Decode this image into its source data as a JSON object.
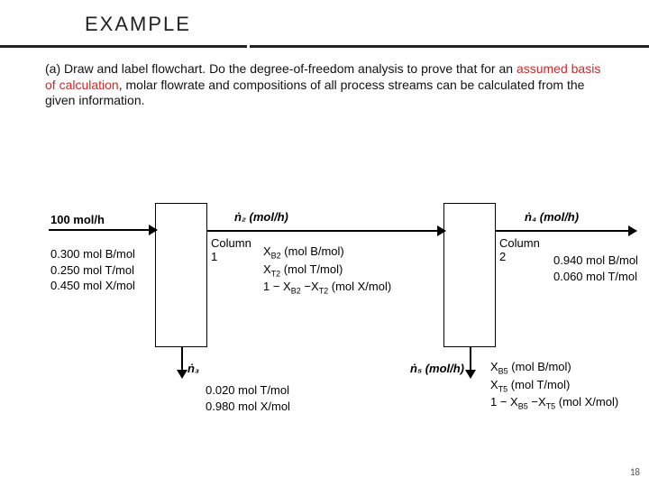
{
  "title": "EXAMPLE",
  "question_parts": {
    "pre": "(a) Draw and label flowchart. Do the degree-of-freedom analysis to prove that for an ",
    "emph": "assumed basis of calculation",
    "post": ", molar flowrate and compositions of all process streams can be calculated from the given information."
  },
  "column1": "Column 1",
  "column2": "Column 2",
  "feed_rate": "100 mol/h",
  "feed_comp": "0.300 mol B/mol\n0.250 mol T/mol\n0.450 mol X/mol",
  "n2_label": "ṅ₂ (mol/h)",
  "s2_comp_html": "X<sub>B2</sub> (mol B/mol)<br>X<sub>T2</sub> (mol T/mol)<br>1 − X<sub>B2</sub> −X<sub>T2</sub> (mol X/mol)",
  "n3_label": "ṅ₃",
  "s3_comp": "0.020 mol T/mol\n0.980 mol X/mol",
  "n4_label": "ṅ₄ (mol/h)",
  "s4_comp": "0.940 mol B/mol\n0.060 mol T/mol",
  "n5_label": "ṅ₅ (mol/h)",
  "s5_comp_html": "X<sub>B5</sub> (mol B/mol)<br>X<sub>T5</sub> (mol T/mol)<br>1 − X<sub>B5</sub> −X<sub>T5</sub> (mol X/mol)",
  "pagenum": "18",
  "chart_data": {
    "type": "diagram",
    "units": [
      "Column 1",
      "Column 2"
    ],
    "streams": [
      {
        "id": "feed",
        "to": "Column 1",
        "rate_mol_per_h": 100,
        "composition": {
          "B": 0.3,
          "T": 0.25,
          "X": 0.45
        }
      },
      {
        "id": "n2",
        "from": "Column 1",
        "to": "Column 2",
        "rate": "ṅ₂",
        "composition": {
          "B": "X_B2",
          "T": "X_T2",
          "X": "1 − X_B2 − X_T2"
        }
      },
      {
        "id": "n3",
        "from": "Column 1",
        "direction": "bottom",
        "rate": "ṅ₃",
        "composition": {
          "T": 0.02,
          "X": 0.98
        }
      },
      {
        "id": "n4",
        "from": "Column 2",
        "direction": "right",
        "rate": "ṅ₄",
        "composition": {
          "B": 0.94,
          "T": 0.06
        }
      },
      {
        "id": "n5",
        "from": "Column 2",
        "direction": "bottom",
        "rate": "ṅ₅",
        "composition": {
          "B": "X_B5",
          "T": "X_T5",
          "X": "1 − X_B5 − X_T5"
        }
      }
    ]
  }
}
